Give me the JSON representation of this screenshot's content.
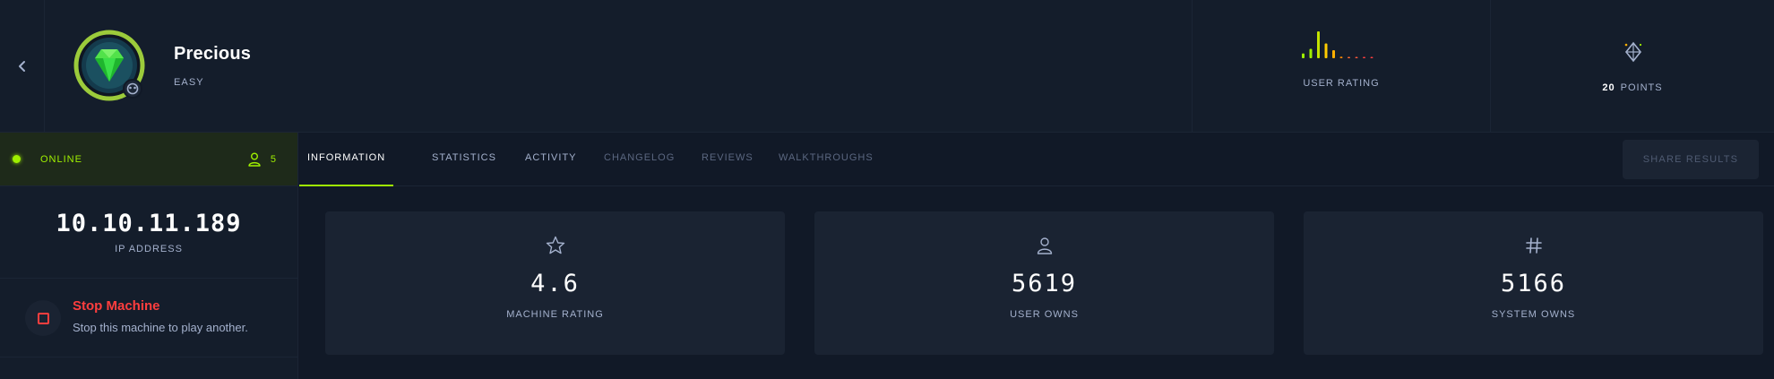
{
  "machine": {
    "name": "Precious",
    "difficulty": "EASY"
  },
  "header": {
    "user_rating_label": "USER RATING",
    "points_value": "20",
    "points_label": "POINTS",
    "rating_bars": [
      {
        "value": 0.18,
        "color": "#9fef00"
      },
      {
        "value": 0.35,
        "color": "#9fef00"
      },
      {
        "value": 1.0,
        "color": "#c4e300"
      },
      {
        "value": 0.55,
        "color": "#ffcc00"
      },
      {
        "value": 0.3,
        "color": "#ffaf00"
      },
      {
        "value": 0.06,
        "color": "#ff8a00"
      },
      {
        "value": 0.04,
        "color": "#ff6a33"
      },
      {
        "value": 0.04,
        "color": "#ff5a3c"
      },
      {
        "value": 0.04,
        "color": "#ff3e3e"
      },
      {
        "value": 0.04,
        "color": "#ff3e3e"
      }
    ]
  },
  "sidebar": {
    "status": "ONLINE",
    "players": "5",
    "ip": "10.10.11.189",
    "ip_label": "IP ADDRESS",
    "stop_title": "Stop Machine",
    "stop_subtitle": "Stop this machine to play another."
  },
  "tabs": [
    {
      "label": "INFORMATION",
      "state": "active"
    },
    {
      "label": "STATISTICS",
      "state": "normal"
    },
    {
      "label": "ACTIVITY",
      "state": "normal"
    },
    {
      "label": "CHANGELOG",
      "state": "dim"
    },
    {
      "label": "REVIEWS",
      "state": "dim"
    },
    {
      "label": "WALKTHROUGHS",
      "state": "dim"
    }
  ],
  "share_button": "SHARE RESULTS",
  "cards": [
    {
      "icon": "star-icon",
      "value": "4.6",
      "label": "MACHINE RATING"
    },
    {
      "icon": "user-icon",
      "value": "5619",
      "label": "USER OWNS"
    },
    {
      "icon": "hash-icon",
      "value": "5166",
      "label": "SYSTEM OWNS"
    }
  ],
  "colors": {
    "accent": "#9fef00",
    "danger": "#ff3e3e",
    "background": "#111927",
    "panel": "#1a2332"
  }
}
